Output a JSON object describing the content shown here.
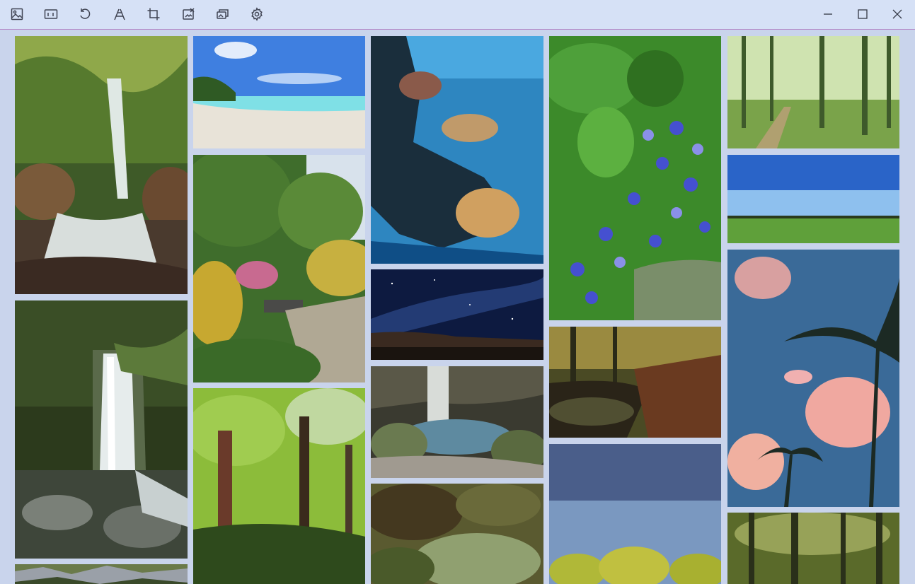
{
  "toolbar": {
    "tools": [
      {
        "name": "image-icon"
      },
      {
        "name": "aspect-ratio-icon"
      },
      {
        "name": "rotate-icon"
      },
      {
        "name": "perspective-icon"
      },
      {
        "name": "crop-icon"
      },
      {
        "name": "remove-image-icon"
      },
      {
        "name": "gallery-icon"
      },
      {
        "name": "gear-icon"
      }
    ],
    "window_controls": [
      {
        "name": "minimize-icon"
      },
      {
        "name": "maximize-icon"
      },
      {
        "name": "close-icon"
      }
    ]
  },
  "gallery": {
    "photos": [
      {
        "name": "photo-forest-waterfall",
        "colors": [
          "#3e5a28",
          "#7a8d3f",
          "#5a4a38"
        ]
      },
      {
        "name": "photo-tropical-beach",
        "colors": [
          "#3f7fe0",
          "#7fe0e6",
          "#e8e3d8"
        ]
      },
      {
        "name": "photo-coral-reef",
        "colors": [
          "#0f4e86",
          "#2e86c0",
          "#1a2e3c"
        ]
      },
      {
        "name": "photo-blue-flowers",
        "colors": [
          "#3c8a2a",
          "#4550d0",
          "#7a8e6a"
        ]
      },
      {
        "name": "photo-birch-forest-path",
        "colors": [
          "#cfe3b0",
          "#7aa34a",
          "#3e5a2b"
        ]
      },
      {
        "name": "photo-green-field-blue-sky",
        "colors": [
          "#2a64c8",
          "#8ec0ee",
          "#5fa03a"
        ]
      },
      {
        "name": "photo-garden-bench",
        "colors": [
          "#3f6d2c",
          "#c7a830",
          "#b0a894"
        ]
      },
      {
        "name": "photo-milky-way",
        "colors": [
          "#0d1a40",
          "#2e4a8a",
          "#3a2a20"
        ]
      },
      {
        "name": "photo-forest-stream",
        "colors": [
          "#4a4a24",
          "#9a8a40",
          "#6a3a20"
        ]
      },
      {
        "name": "photo-palm-sky",
        "colors": [
          "#3a6a98",
          "#f0a8a0",
          "#1c2a24"
        ]
      },
      {
        "name": "photo-mossy-waterfall",
        "colors": [
          "#2c3a1c",
          "#dfe6e6",
          "#4a4a40"
        ]
      },
      {
        "name": "photo-cave-pool",
        "colors": [
          "#3a3a30",
          "#5e8aa0",
          "#6a7a50"
        ]
      },
      {
        "name": "photo-tall-trees",
        "colors": [
          "#8cbc3a",
          "#2e4a1c",
          "#c0d8a0"
        ]
      },
      {
        "name": "photo-blurred-foliage",
        "colors": [
          "#5a5a30",
          "#90a070",
          "#3a2a18"
        ]
      },
      {
        "name": "photo-treetops-dusk",
        "colors": [
          "#4a5e8a",
          "#7a98c0",
          "#b0b838"
        ]
      },
      {
        "name": "photo-bamboo",
        "colors": [
          "#5a6a2a",
          "#c0c878",
          "#2a301a"
        ]
      },
      {
        "name": "photo-rocky-mountain",
        "colors": [
          "#6a7a4a",
          "#9aa0a8",
          "#3a4a2a"
        ]
      }
    ]
  }
}
